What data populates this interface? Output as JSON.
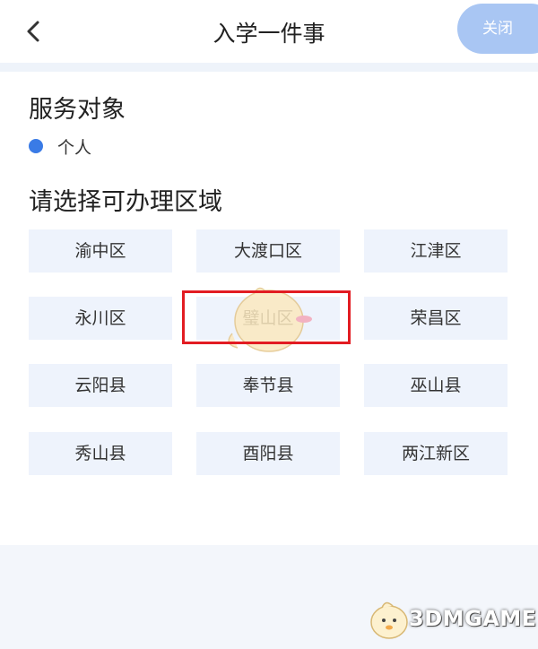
{
  "header": {
    "title": "入学一件事",
    "close_label": "关闭"
  },
  "service_target": {
    "heading": "服务对象",
    "selected_option": "个人",
    "accent": "#3a7be6"
  },
  "region_select": {
    "heading": "请选择可办理区域",
    "districts": [
      [
        "渝中区",
        "大渡口区",
        "江津区"
      ],
      [
        "永川区",
        "璧山区",
        "荣昌区"
      ],
      [
        "云阳县",
        "奉节县",
        "巫山县"
      ],
      [
        "秀山县",
        "酉阳县",
        "两江新区"
      ]
    ],
    "highlighted": "璧山区",
    "highlight_color": "#e21c22"
  },
  "watermark": {
    "text": "3DMGAME"
  }
}
